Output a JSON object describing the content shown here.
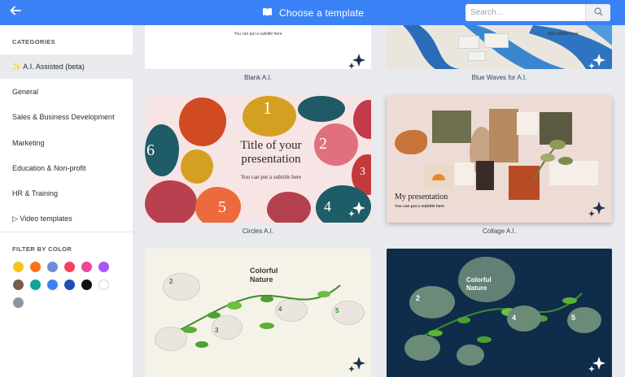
{
  "header": {
    "title": "Choose a template",
    "search_placeholder": "Search..."
  },
  "sidebar": {
    "categories_heading": "CATEGORIES",
    "categories": [
      {
        "label": "✨ A.I. Assisted (beta)",
        "active": true
      },
      {
        "label": "General"
      },
      {
        "label": "Sales & Business Development"
      },
      {
        "label": "Marketing"
      },
      {
        "label": "Education & Non-profit"
      },
      {
        "label": "HR & Training"
      },
      {
        "label": "▷ Video templates"
      }
    ],
    "color_heading": "FILTER BY COLOR",
    "colors": [
      "#f5c518",
      "#f97316",
      "#6b8fd6",
      "#f43f5e",
      "#ec4899",
      "#a855f7",
      "#7a5a48",
      "#14a39a",
      "#3b82f6",
      "#1e4db7",
      "#111111",
      "#ffffff",
      "#8b95a5"
    ]
  },
  "templates": [
    {
      "name": "Blank A.I.",
      "subtitle": "You can put a subtitle here"
    },
    {
      "name": "Blue Waves for A.I.",
      "fragment": "Add subtitle here"
    },
    {
      "name": "Circles A.I.",
      "title": "Title of your presentation",
      "subtitle": "You can put a subtitle here",
      "numbers": [
        "1",
        "2",
        "3",
        "4",
        "5",
        "6"
      ]
    },
    {
      "name": "Collage A.I.",
      "title": "My presentation",
      "subtitle": "You can put a subtitle here"
    },
    {
      "name": "",
      "title_line1": "Colorful",
      "title_line2": "Nature",
      "numbers": [
        "2",
        "3",
        "4",
        "5"
      ]
    },
    {
      "name": "",
      "title_line1": "Colorful",
      "title_line2": "Nature",
      "numbers": [
        "2",
        "4",
        "5"
      ]
    }
  ]
}
